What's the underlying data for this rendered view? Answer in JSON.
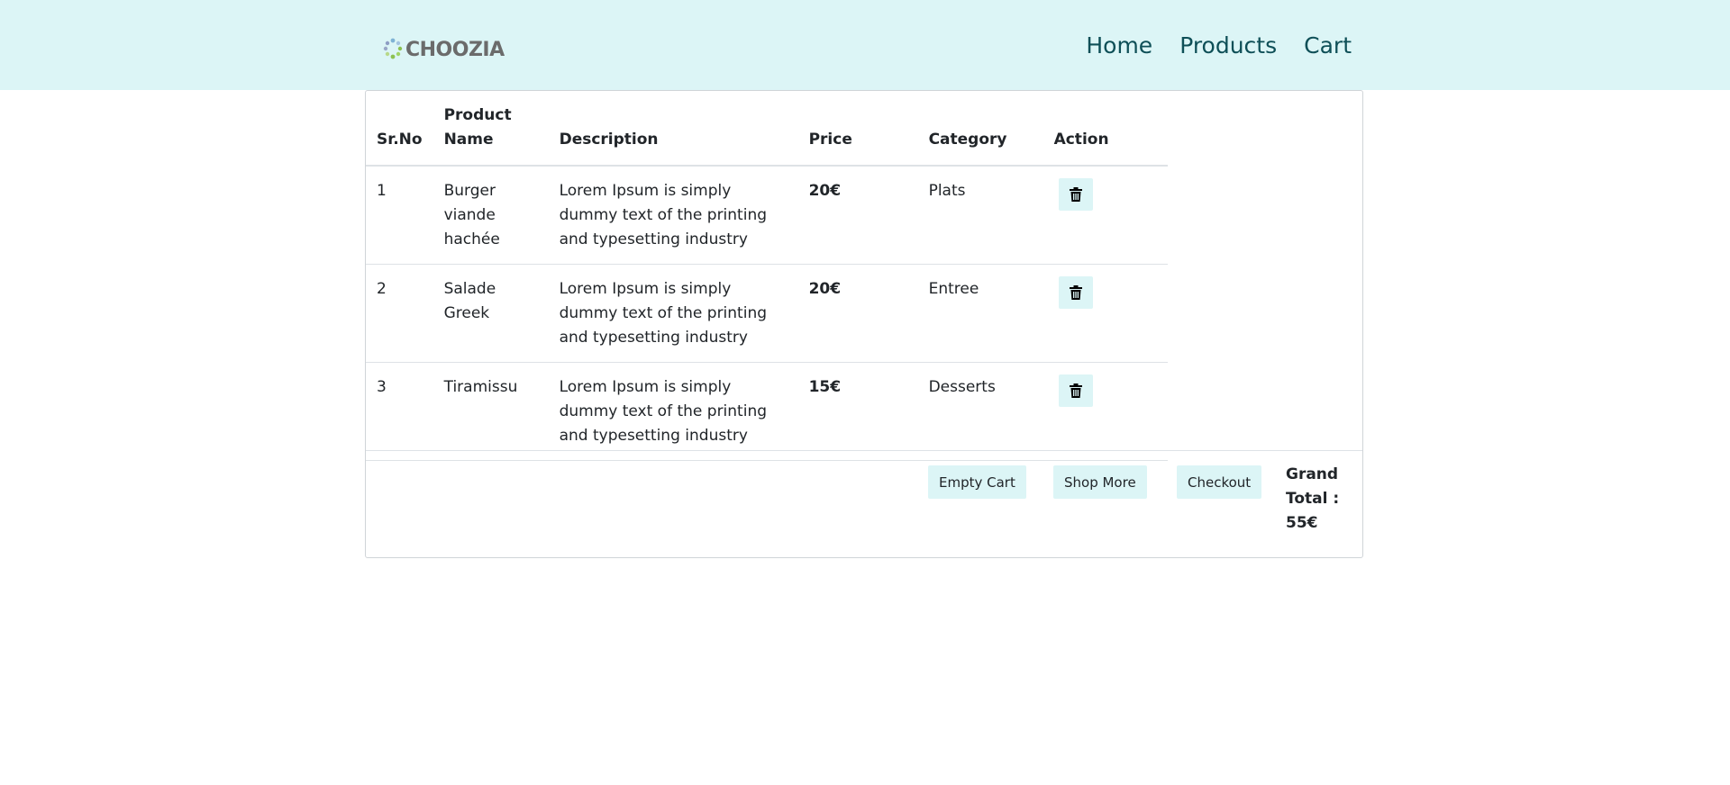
{
  "brand": {
    "name": "CHOOZIA",
    "logo_icon": "choozia-logo-dots"
  },
  "nav": {
    "home": "Home",
    "products": "Products",
    "cart": "Cart"
  },
  "table": {
    "headers": {
      "sr": "Sr.No",
      "name": "Product Name",
      "description": "Description",
      "price": "Price",
      "category": "Category",
      "action": "Action"
    },
    "rows": [
      {
        "sr": "1",
        "name": "Burger viande hachée",
        "description": "Lorem Ipsum is simply dummy text of the printing and typesetting industry",
        "price": "20€",
        "category": "Plats",
        "action_icon": "trash-icon"
      },
      {
        "sr": "2",
        "name": "Salade Greek",
        "description": "Lorem Ipsum is simply dummy text of the printing and typesetting industry",
        "price": "20€",
        "category": "Entree",
        "action_icon": "trash-icon"
      },
      {
        "sr": "3",
        "name": "Tiramissu",
        "description": "Lorem Ipsum is simply dummy text of the printing and typesetting industry",
        "price": "15€",
        "category": "Desserts",
        "action_icon": "trash-icon"
      }
    ]
  },
  "footer": {
    "empty_cart": "Empty Cart",
    "shop_more": "Shop More",
    "checkout": "Checkout",
    "grand_total": "Grand Total : 55€"
  },
  "colors": {
    "navbar_bg": "#dcf5f6",
    "nav_link": "#0e4f57",
    "button_bg": "#dcf5f6"
  }
}
